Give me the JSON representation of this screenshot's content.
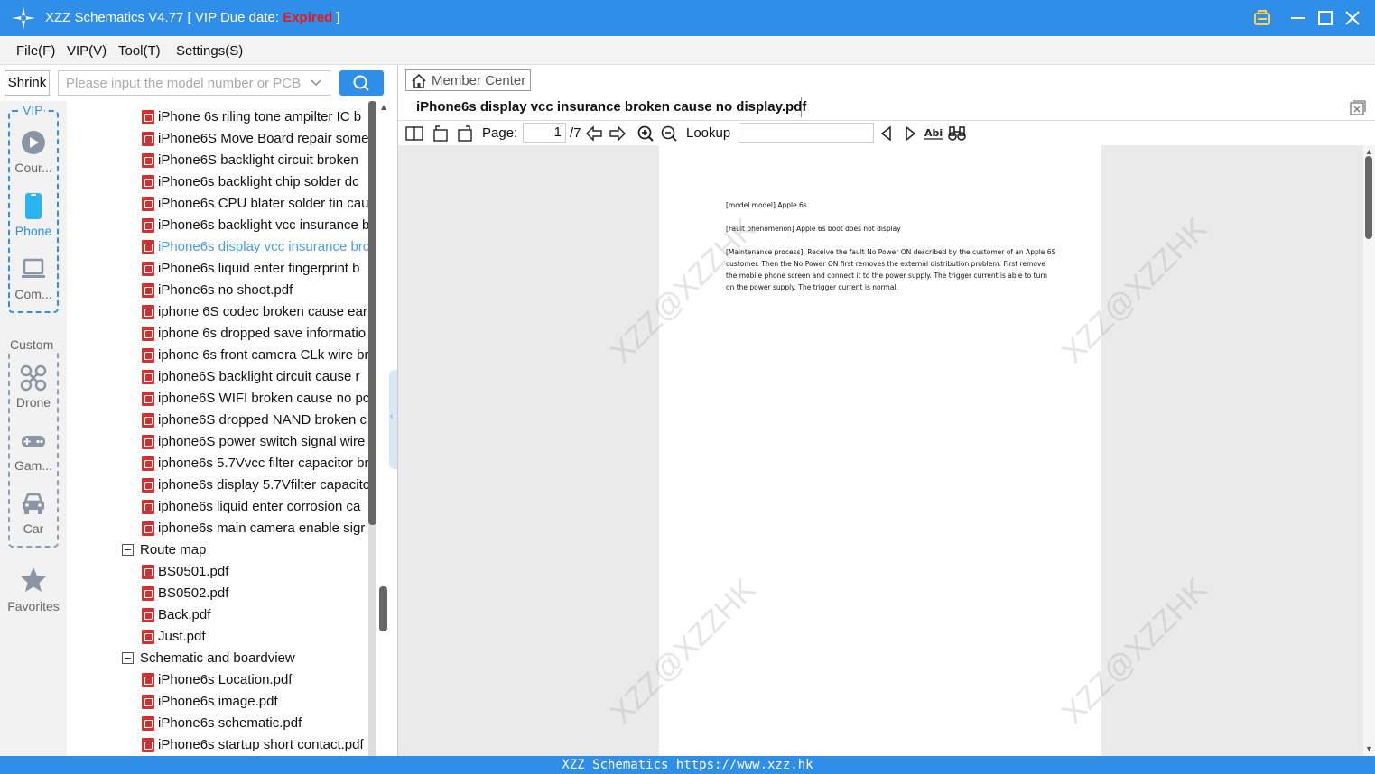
{
  "app": {
    "title_prefix": "XZZ Schematics V4.77 [ VIP Due date: ",
    "title_status": "Expired",
    "title_suffix": " ]"
  },
  "menu": [
    "File(F)",
    "VIP(V)",
    "Tool(T)",
    "Settings(S)"
  ],
  "search": {
    "shrink_label": "Shrink",
    "placeholder": "Please input the model number or PCB"
  },
  "rail": {
    "vip_group_label": "VIP",
    "custom_group_label": "Custom",
    "items": [
      {
        "label": "Cour...",
        "icon": "play-circle-icon"
      },
      {
        "label": "Phone",
        "icon": "phone-icon"
      },
      {
        "label": "Com...",
        "icon": "laptop-icon"
      },
      {
        "label": "Drone",
        "icon": "drone-icon"
      },
      {
        "label": "Gam...",
        "icon": "gamepad-icon"
      },
      {
        "label": "Car",
        "icon": "car-icon"
      },
      {
        "label": "Favorites",
        "icon": "star-icon"
      }
    ]
  },
  "tree": {
    "rows": [
      {
        "type": "file",
        "text": "iPhone 6s riling tone ampilter IC b"
      },
      {
        "type": "file",
        "text": "iPhone6S Move Board repair some"
      },
      {
        "type": "file",
        "text": "iPhone6S backlight circuit broken"
      },
      {
        "type": "file",
        "text": "iPhone6s  backlight chip solder dc"
      },
      {
        "type": "file",
        "text": "iPhone6s CPU blater solder tin cau"
      },
      {
        "type": "file",
        "text": "iPhone6s backlight vcc insurance b"
      },
      {
        "type": "file",
        "text": "iPhone6s display vcc insurance brc",
        "selected": true
      },
      {
        "type": "file",
        "text": "iPhone6s liquid enter fingerprint b"
      },
      {
        "type": "file",
        "text": "iPhone6s no shoot.pdf"
      },
      {
        "type": "file",
        "text": "iphone 6S codec broken cause ear"
      },
      {
        "type": "file",
        "text": "iphone 6s dropped save informatio"
      },
      {
        "type": "file",
        "text": "iphone 6s front camera CLk wire br"
      },
      {
        "type": "file",
        "text": "iphone6S  backlight circuit cause r"
      },
      {
        "type": "file",
        "text": "iphone6S WIFI broken cause no pc"
      },
      {
        "type": "file",
        "text": "iphone6S dropped NAND broken c"
      },
      {
        "type": "file",
        "text": "iphone6S power switch signal wire"
      },
      {
        "type": "file",
        "text": "iphone6s 5.7Vvcc filter capacitor br"
      },
      {
        "type": "file",
        "text": "iphone6s display 5.7Vfilter capacito"
      },
      {
        "type": "file",
        "text": "iphone6s liquid enter corrosion ca"
      },
      {
        "type": "file",
        "text": "iphone6s main camera enable sigr"
      },
      {
        "type": "folder",
        "text": "Route map"
      },
      {
        "type": "file",
        "text": "BS0501.pdf"
      },
      {
        "type": "file",
        "text": "BS0502.pdf"
      },
      {
        "type": "file",
        "text": "Back.pdf"
      },
      {
        "type": "file",
        "text": "Just.pdf"
      },
      {
        "type": "folder",
        "text": "Schematic and boardview"
      },
      {
        "type": "file",
        "text": "iPhone6s Location.pdf"
      },
      {
        "type": "file",
        "text": "iPhone6s image.pdf"
      },
      {
        "type": "file",
        "text": "iPhone6s schematic.pdf"
      },
      {
        "type": "file",
        "text": "iPhone6s startup short contact.pdf"
      }
    ]
  },
  "viewer": {
    "member_center": "Member Center",
    "doc_tab": "iPhone6s display vcc insurance broken cause no display.pdf",
    "page_label": "Page:",
    "page_current": "1",
    "page_total": "/7",
    "lookup_label": "Lookup",
    "lookup_value": "",
    "watermark": "XZZ@XZZHK",
    "page_lines": [
      "[model model] Apple 6s",
      "[Fault phenomenon] Apple 6s boot does not display",
      "[Maintenance process]: Receive the fault No Power ON described by the customer of an Apple 6S",
      "customer. Then the No Power ON first removes the external distribution problem. First remove",
      "the mobile phone screen and connect it to the power supply. The trigger current is able to turn",
      "on the power supply. The trigger current is normal."
    ]
  },
  "status": {
    "text": "XZZ Schematics https://www.xzz.hk"
  },
  "colors": {
    "accent": "#2e8ee8",
    "expired": "#e81818",
    "pdf_icon": "#d32f2f"
  }
}
